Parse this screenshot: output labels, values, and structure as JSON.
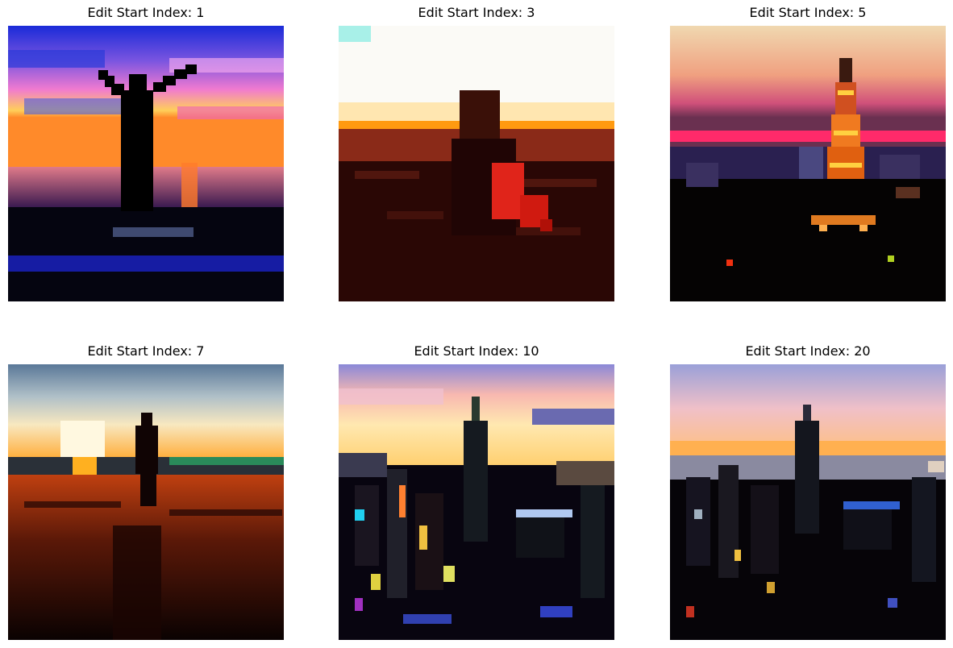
{
  "figure": {
    "panels": [
      {
        "title": "Edit Start Index: 1",
        "image_content": "silhouette of a person with raised arms at sunset over the sea, vivid pink and blue clouds"
      },
      {
        "title": "Edit Start Index: 3",
        "image_content": "silhouette of a woman in a field at sunset, red scarf, bright white sky"
      },
      {
        "title": "Edit Start Index: 5",
        "image_content": "Eiffel Tower lit at dusk over a city skyline, pink and orange sky"
      },
      {
        "title": "Edit Start Index: 7",
        "image_content": "silhouette of a person standing on a beach with long shadows at sunset"
      },
      {
        "title": "Edit Start Index: 10",
        "image_content": "Empire State Building and New York skyline at sunset, colorful pixelated lights"
      },
      {
        "title": "Edit Start Index: 20",
        "image_content": "Empire State Building and New York skyline at dusk, muted sky"
      }
    ]
  }
}
